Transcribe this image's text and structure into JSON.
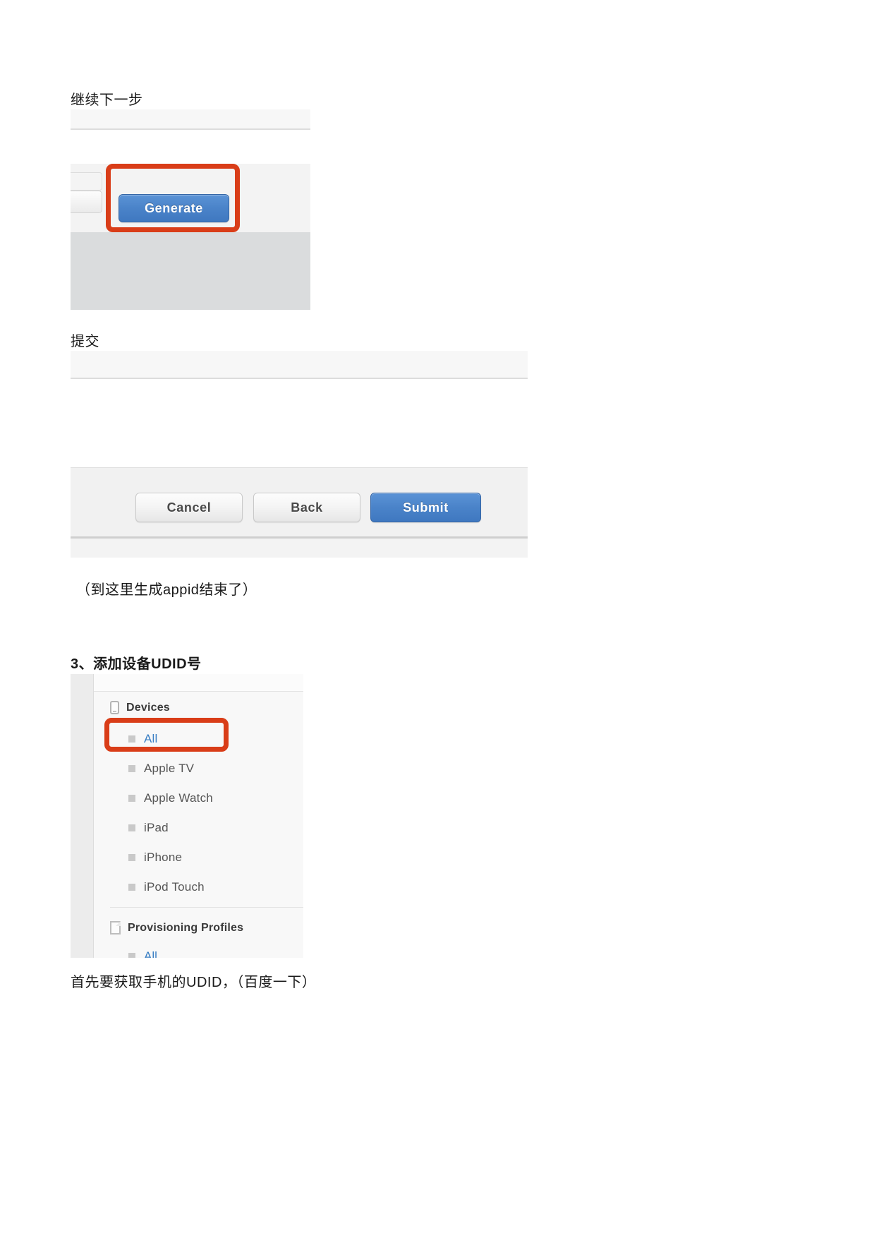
{
  "document": {
    "language": "zh-CN"
  },
  "colors": {
    "highlight_box": "#D93D18",
    "primary_button": "#4A83C9",
    "link": "#3A7FC4",
    "body_text": "#1A1A1A"
  },
  "sections": {
    "continue_step": {
      "label": "继续下一步"
    },
    "generate_shot": {
      "generate_button": "Generate",
      "highlight_name": "generate-button-highlight"
    },
    "submit_step": {
      "label": "提交"
    },
    "footer_shot": {
      "cancel_button": "Cancel",
      "back_button": "Back",
      "submit_button": "Submit"
    },
    "note_appid": {
      "text": "（到这里生成appid结束了）"
    },
    "heading_udid": {
      "text": "3、添加设备UDID号"
    },
    "devices_shot": {
      "devices_group": {
        "title": "Devices",
        "icon": "phone-icon",
        "items": [
          {
            "label": "All",
            "selected": true,
            "highlighted": true
          },
          {
            "label": "Apple TV",
            "selected": false,
            "highlighted": false
          },
          {
            "label": "Apple Watch",
            "selected": false,
            "highlighted": false
          },
          {
            "label": "iPad",
            "selected": false,
            "highlighted": false
          },
          {
            "label": "iPhone",
            "selected": false,
            "highlighted": false
          },
          {
            "label": "iPod Touch",
            "selected": false,
            "highlighted": false
          }
        ]
      },
      "profiles_group": {
        "title": "Provisioning Profiles",
        "icon": "document-icon",
        "items": [
          {
            "label": "All"
          }
        ]
      }
    },
    "note_udid": {
      "text": "首先要获取手机的UDID，（百度一下）"
    }
  }
}
